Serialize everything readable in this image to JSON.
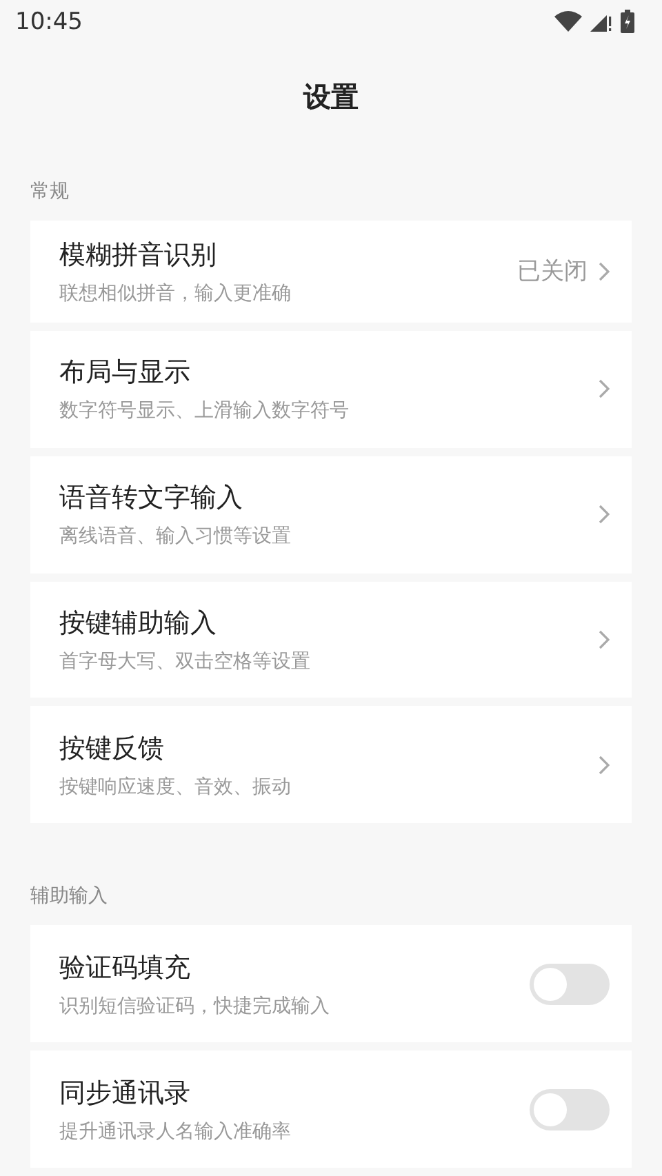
{
  "status_bar": {
    "time": "10:45"
  },
  "title": "设置",
  "sections": [
    {
      "label": "常规",
      "items": [
        {
          "kind": "link",
          "title": "模糊拼音识别",
          "subtitle": "联想相似拼音，输入更准确",
          "value": "已关闭"
        },
        {
          "kind": "link",
          "title": "布局与显示",
          "subtitle": "数字符号显示、上滑输入数字符号"
        },
        {
          "kind": "link",
          "title": "语音转文字输入",
          "subtitle": "离线语音、输入习惯等设置"
        },
        {
          "kind": "link",
          "title": "按键辅助输入",
          "subtitle": "首字母大写、双击空格等设置"
        },
        {
          "kind": "link",
          "title": "按键反馈",
          "subtitle": "按键响应速度、音效、振动"
        }
      ]
    },
    {
      "label": "辅助输入",
      "items": [
        {
          "kind": "toggle",
          "title": "验证码填充",
          "subtitle": "识别短信验证码，快捷完成输入",
          "on": false
        },
        {
          "kind": "toggle",
          "title": "同步通讯录",
          "subtitle": "提升通讯录人名输入准确率",
          "on": false
        }
      ]
    }
  ]
}
